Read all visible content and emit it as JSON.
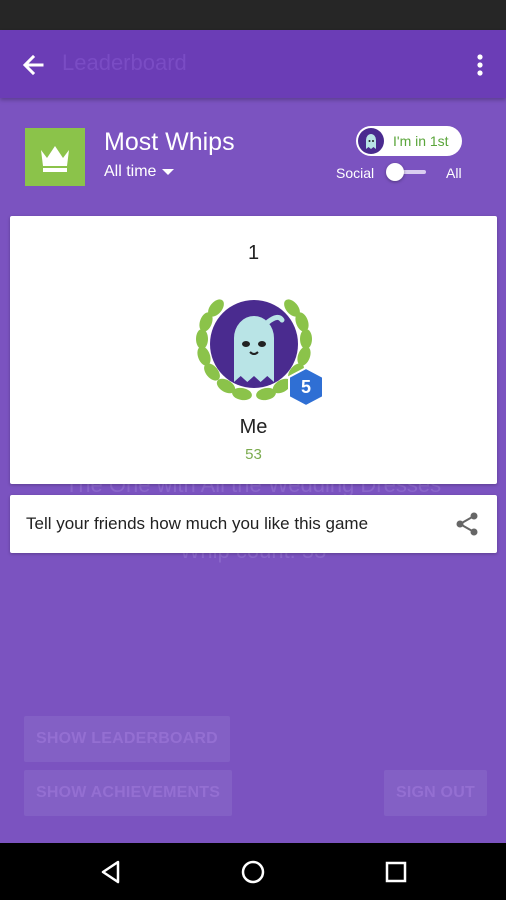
{
  "app_bar": {
    "faded_title": "Leaderboard"
  },
  "background": {
    "faded_line1": "The One with All the Wedding Dresses",
    "faded_line2": "Whip count: 53",
    "buttons": {
      "show_leaderboard": "SHOW LEADERBOARD",
      "show_achievements": "SHOW ACHIEVEMENTS",
      "sign_out": "SIGN OUT"
    }
  },
  "leaderboard": {
    "title": "Most Whips",
    "time_filter": "All time",
    "rank_badge": "I'm in 1st",
    "toggle": {
      "left_label": "Social",
      "right_label": "All"
    }
  },
  "player_card": {
    "rank": "1",
    "name": "Me",
    "score": "53",
    "level": "5"
  },
  "share": {
    "text": "Tell your friends how much you like this game"
  },
  "colors": {
    "app_bar": "#6b3db6",
    "background": "#7b53c0",
    "leaderboard_icon": "#8bc34a",
    "score_green": "#7bab4e",
    "level_badge": "#2f6fd4"
  }
}
